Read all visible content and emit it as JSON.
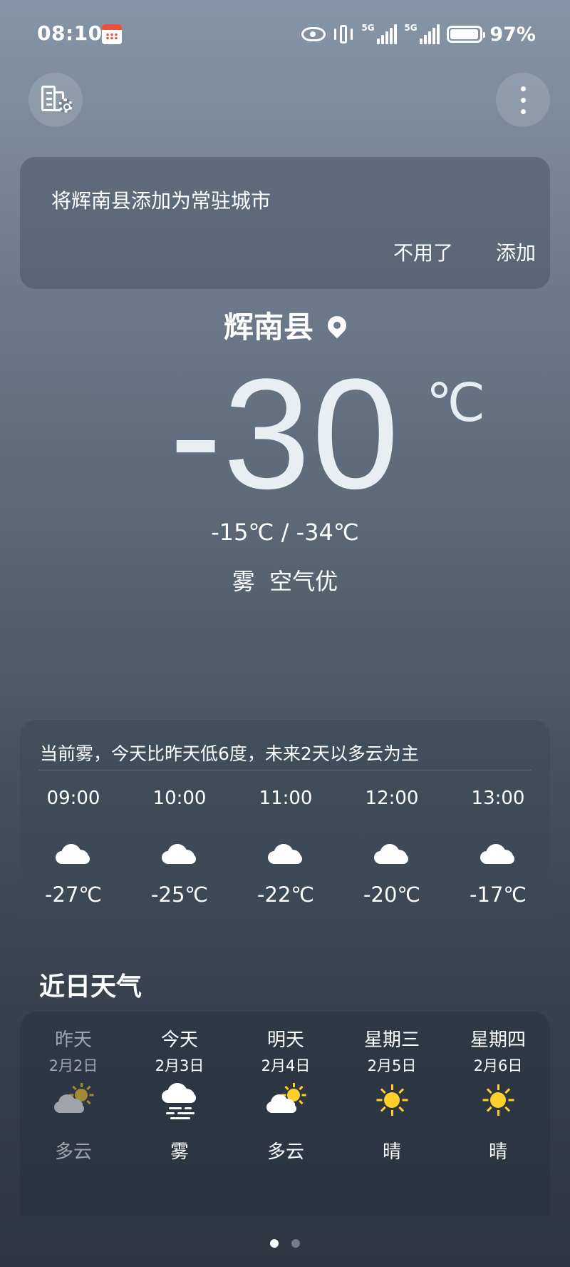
{
  "status_bar": {
    "time": "08:10",
    "net1": "5G",
    "net2": "5G",
    "battery_level": 0.97,
    "battery_pct": "97%"
  },
  "notice": {
    "message": "将辉南县添加为常驻城市",
    "dismiss_label": "不用了",
    "add_label": "添加"
  },
  "current": {
    "city": "辉南县",
    "temperature": "-30",
    "unit": "℃",
    "range": "-15℃ / -34℃",
    "condition": "雾  空气优"
  },
  "hourly": {
    "summary": "当前雾，今天比昨天低6度，未来2天以多云为主",
    "items": [
      {
        "time": "09:00",
        "icon": "cloud-icon",
        "temp": "-27℃"
      },
      {
        "time": "10:00",
        "icon": "cloud-icon",
        "temp": "-25℃"
      },
      {
        "time": "11:00",
        "icon": "cloud-icon",
        "temp": "-22℃"
      },
      {
        "time": "12:00",
        "icon": "cloud-icon",
        "temp": "-20℃"
      },
      {
        "time": "13:00",
        "icon": "cloud-icon",
        "temp": "-17℃"
      }
    ]
  },
  "daily": {
    "title": "近日天气",
    "items": [
      {
        "day": "昨天",
        "date": "2月2日",
        "icon": "partly-cloudy-icon",
        "cond": "多云"
      },
      {
        "day": "今天",
        "date": "2月3日",
        "icon": "fog-icon",
        "cond": "雾"
      },
      {
        "day": "明天",
        "date": "2月4日",
        "icon": "partly-cloudy-icon",
        "cond": "多云"
      },
      {
        "day": "星期三",
        "date": "2月5日",
        "icon": "sun-icon",
        "cond": "晴"
      },
      {
        "day": "星期四",
        "date": "2月6日",
        "icon": "sun-icon",
        "cond": "晴"
      }
    ]
  },
  "colors": {
    "sun": "#ffd029",
    "cloud": "#ffffff"
  },
  "pager": {
    "count": 2,
    "active": 0
  }
}
